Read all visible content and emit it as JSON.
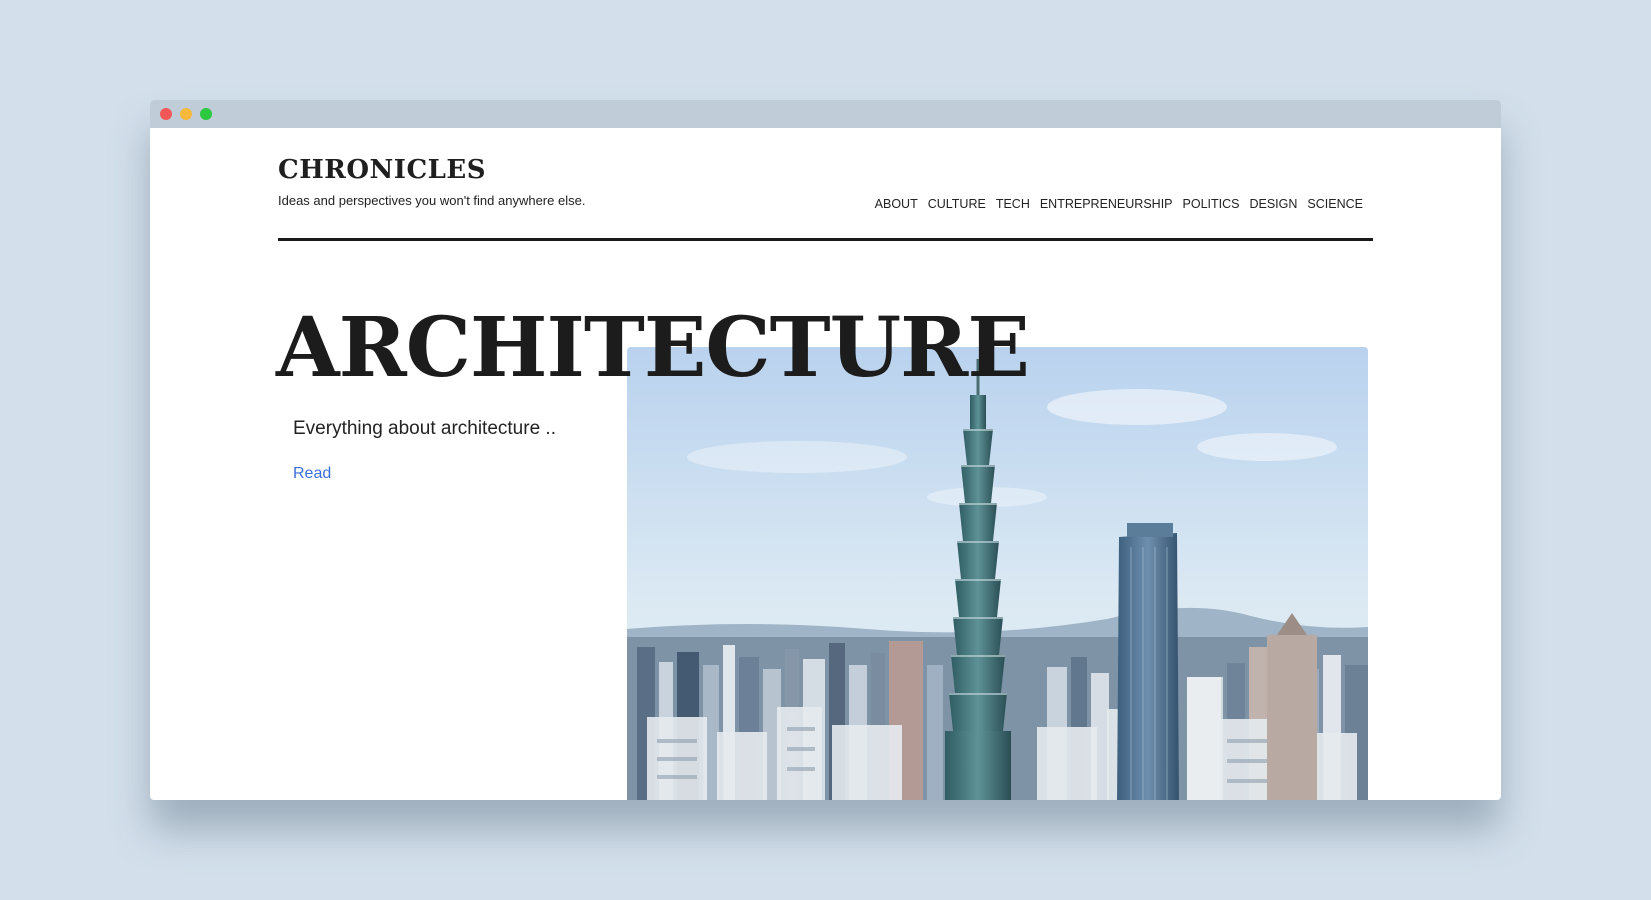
{
  "site": {
    "brand": "CHRONICLES",
    "tagline": "Ideas and perspectives you won't find anywhere else."
  },
  "nav": {
    "items": [
      {
        "label": "ABOUT"
      },
      {
        "label": "CULTURE"
      },
      {
        "label": "TECH"
      },
      {
        "label": "ENTREPRENEURSHIP"
      },
      {
        "label": "POLITICS"
      },
      {
        "label": "DESIGN"
      },
      {
        "label": "SCIENCE"
      }
    ]
  },
  "hero": {
    "title": "ARCHITECTURE",
    "description": "Everything about architecture ..",
    "link_label": "Read"
  },
  "colors": {
    "page_background": "#d3e0ec",
    "titlebar": "#c0cdd8",
    "link": "#3b6fd8",
    "text": "#1c1c1c"
  }
}
